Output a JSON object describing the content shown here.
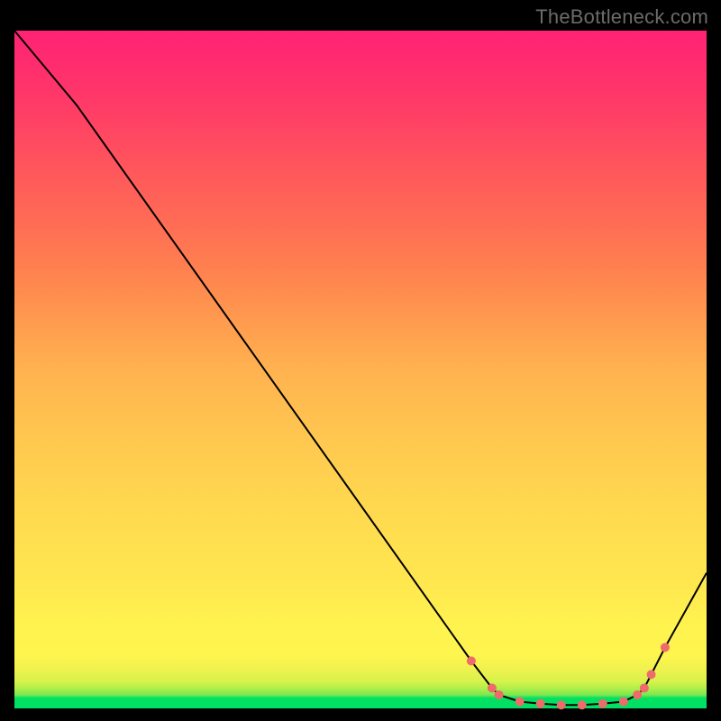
{
  "watermark": "TheBottleneck.com",
  "chart_data": {
    "type": "line",
    "title": "",
    "xlabel": "",
    "ylabel": "",
    "x_range": [
      0,
      100
    ],
    "y_range": [
      0,
      100
    ],
    "series": [
      {
        "name": "bottleneck-curve",
        "x": [
          0,
          9,
          66,
          69,
          70,
          73,
          76,
          79,
          82,
          85,
          88,
          90,
          91,
          92,
          94,
          100
        ],
        "y": [
          100,
          89,
          7,
          3,
          2,
          1,
          0.7,
          0.5,
          0.5,
          0.7,
          1,
          2,
          3,
          5,
          9,
          20
        ]
      }
    ],
    "markers": {
      "name": "highlight-dots",
      "x": [
        66,
        69,
        70,
        73,
        76,
        79,
        82,
        85,
        88,
        90,
        91,
        92,
        94
      ],
      "y": [
        7,
        3,
        2,
        1,
        0.7,
        0.5,
        0.5,
        0.7,
        1,
        2,
        3,
        5,
        9
      ]
    },
    "colors": {
      "line": "#000000",
      "marker": "#ef6b6b"
    }
  }
}
